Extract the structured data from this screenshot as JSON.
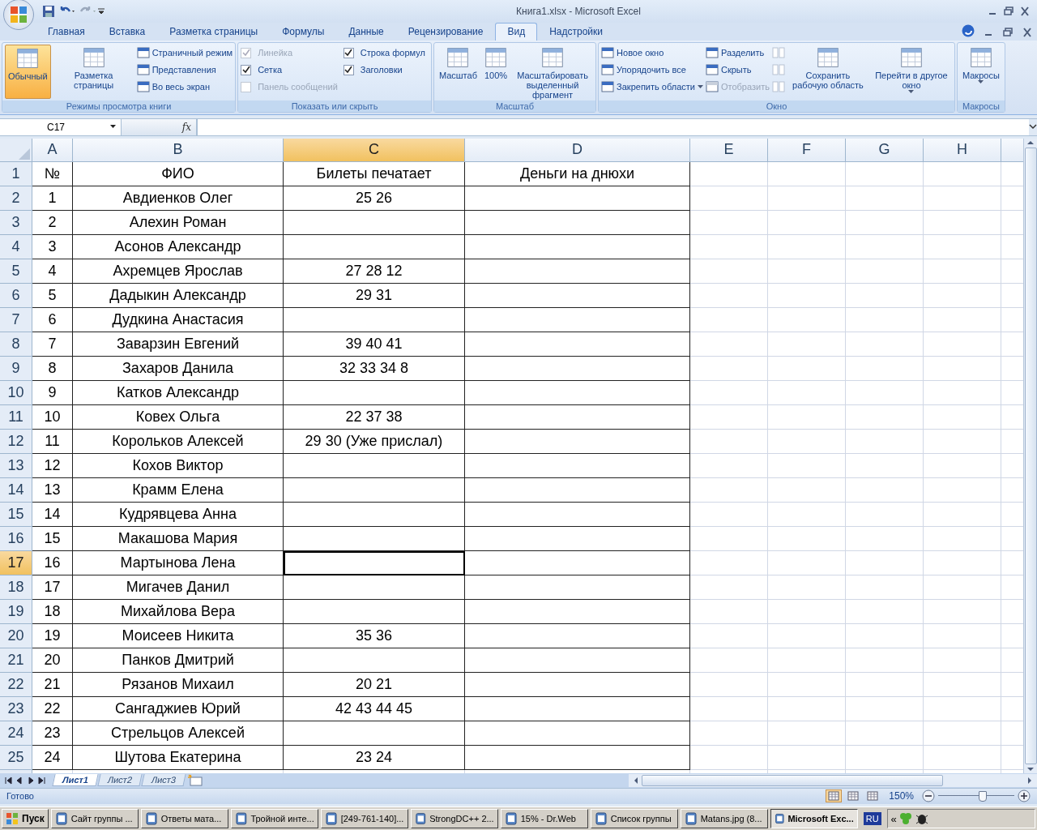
{
  "window": {
    "title": "Книга1.xlsx - Microsoft Excel"
  },
  "tabs": [
    {
      "label": "Главная",
      "selected": false
    },
    {
      "label": "Вставка",
      "selected": false
    },
    {
      "label": "Разметка страницы",
      "selected": false
    },
    {
      "label": "Формулы",
      "selected": false
    },
    {
      "label": "Данные",
      "selected": false
    },
    {
      "label": "Рецензирование",
      "selected": false
    },
    {
      "label": "Вид",
      "selected": true
    },
    {
      "label": "Надстройки",
      "selected": false
    }
  ],
  "ribbon": {
    "groups": [
      {
        "label": "Режимы просмотра книги",
        "blocks": [
          {
            "kind": "large",
            "label": "Обычный",
            "selected": true
          },
          {
            "kind": "large",
            "label": "Разметка страницы",
            "selected": false
          },
          {
            "kind": "stack",
            "items": [
              {
                "kind": "small",
                "label": "Страничный режим",
                "disabled": false
              },
              {
                "kind": "small",
                "label": "Представления",
                "disabled": false
              },
              {
                "kind": "small",
                "label": "Во весь экран",
                "disabled": false
              }
            ]
          }
        ]
      },
      {
        "label": "Показать или скрыть",
        "blocks": [
          {
            "kind": "stack",
            "items": [
              {
                "kind": "checkbox",
                "label": "Линейка",
                "checked": true,
                "disabled": true
              },
              {
                "kind": "checkbox",
                "label": "Сетка",
                "checked": true,
                "disabled": false
              },
              {
                "kind": "checkbox",
                "label": "Панель сообщений",
                "checked": false,
                "disabled": true
              }
            ]
          },
          {
            "kind": "stack",
            "items": [
              {
                "kind": "checkbox",
                "label": "Строка формул",
                "checked": true,
                "disabled": false
              },
              {
                "kind": "checkbox",
                "label": "Заголовки",
                "checked": true,
                "disabled": false
              }
            ]
          }
        ]
      },
      {
        "label": "Масштаб",
        "blocks": [
          {
            "kind": "large",
            "label": "Масштаб"
          },
          {
            "kind": "large",
            "label": "100%"
          },
          {
            "kind": "large",
            "label": "Масштабировать выделенный фрагмент"
          }
        ]
      },
      {
        "label": "Окно",
        "blocks": [
          {
            "kind": "stack",
            "items": [
              {
                "kind": "small",
                "label": "Новое окно",
                "disabled": false
              },
              {
                "kind": "small",
                "label": "Упорядочить все",
                "disabled": false
              },
              {
                "kind": "small",
                "label": "Закрепить области",
                "disabled": false,
                "dropdown": true
              }
            ]
          },
          {
            "kind": "stack",
            "items": [
              {
                "kind": "small",
                "label": "Разделить",
                "disabled": false
              },
              {
                "kind": "small",
                "label": "Скрыть",
                "disabled": false
              },
              {
                "kind": "small",
                "label": "Отобразить",
                "disabled": true
              }
            ]
          },
          {
            "kind": "stack",
            "items": [
              {
                "kind": "icon",
                "disabled": true
              },
              {
                "kind": "icon",
                "disabled": true
              },
              {
                "kind": "icon",
                "disabled": true
              }
            ]
          },
          {
            "kind": "large",
            "label": "Сохранить рабочую область"
          },
          {
            "kind": "large",
            "label": "Перейти в другое окно",
            "dropdown": true
          }
        ]
      },
      {
        "label": "Макросы",
        "blocks": [
          {
            "kind": "large",
            "label": "Макросы",
            "dropdown": true
          }
        ]
      }
    ]
  },
  "formula_bar": {
    "name_box": "C17",
    "function_label": "fx"
  },
  "columns": [
    {
      "label": "A",
      "selected": false
    },
    {
      "label": "B",
      "selected": false
    },
    {
      "label": "C",
      "selected": true
    },
    {
      "label": "D",
      "selected": false
    },
    {
      "label": "E",
      "selected": false
    },
    {
      "label": "F",
      "selected": false
    },
    {
      "label": "G",
      "selected": false
    },
    {
      "label": "H",
      "selected": false
    }
  ],
  "rows": [
    {
      "number": "1",
      "selected": false,
      "a": "№",
      "b": "ФИО",
      "c": "Билеты печатает",
      "d": "Деньги на днюхи"
    },
    {
      "number": "2",
      "selected": false,
      "a": "1",
      "b": "Авдиенков Олег",
      "c": "25 26"
    },
    {
      "number": "3",
      "selected": false,
      "a": "2",
      "b": "Алехин Роман"
    },
    {
      "number": "4",
      "selected": false,
      "a": "3",
      "b": "Асонов Александр"
    },
    {
      "number": "5",
      "selected": false,
      "a": "4",
      "b": "Ахремцев Ярослав",
      "c": "27 28 12"
    },
    {
      "number": "6",
      "selected": false,
      "a": "5",
      "b": "Дадыкин Александр",
      "c": "29 31"
    },
    {
      "number": "7",
      "selected": false,
      "a": "6",
      "b": "Дудкина Анастасия"
    },
    {
      "number": "8",
      "selected": false,
      "a": "7",
      "b": "Заварзин Евгений",
      "c": "39 40 41"
    },
    {
      "number": "9",
      "selected": false,
      "a": "8",
      "b": "Захаров Данила",
      "c": "32 33 34  8"
    },
    {
      "number": "10",
      "selected": false,
      "a": "9",
      "b": "Катков Александр"
    },
    {
      "number": "11",
      "selected": false,
      "a": "10",
      "b": "Ковех Ольга",
      "c": "22 37 38"
    },
    {
      "number": "12",
      "selected": false,
      "a": "11",
      "b": "Корольков Алексей",
      "c": "29 30 (Уже прислал)"
    },
    {
      "number": "13",
      "selected": false,
      "a": "12",
      "b": "Кохов Виктор"
    },
    {
      "number": "14",
      "selected": false,
      "a": "13",
      "b": "Крамм Елена"
    },
    {
      "number": "15",
      "selected": false,
      "a": "14",
      "b": "Кудрявцева Анна"
    },
    {
      "number": "16",
      "selected": false,
      "a": "15",
      "b": "Макашова Мария"
    },
    {
      "number": "17",
      "selected": true,
      "a": "16",
      "b": "Мартынова Лена"
    },
    {
      "number": "18",
      "selected": false,
      "a": "17",
      "b": "Мигачев Данил"
    },
    {
      "number": "19",
      "selected": false,
      "a": "18",
      "b": "Михайлова Вера"
    },
    {
      "number": "20",
      "selected": false,
      "a": "19",
      "b": "Моисеев Никита",
      "c": "35 36"
    },
    {
      "number": "21",
      "selected": false,
      "a": "20",
      "b": "Панков Дмитрий"
    },
    {
      "number": "22",
      "selected": false,
      "a": "21",
      "b": "Рязанов Михаил",
      "c": "20 21"
    },
    {
      "number": "23",
      "selected": false,
      "a": "22",
      "b": "Сангаджиев Юрий",
      "c": "42 43 44 45"
    },
    {
      "number": "24",
      "selected": false,
      "a": "23",
      "b": "Стрельцов Алексей"
    },
    {
      "number": "25",
      "selected": false,
      "a": "24",
      "b": "Шутова Екатерина",
      "c": "23 24"
    }
  ],
  "sheets": [
    {
      "label": "Лист1",
      "selected": true
    },
    {
      "label": "Лист2",
      "selected": false
    },
    {
      "label": "Лист3",
      "selected": false
    }
  ],
  "status_bar": {
    "text": "Готово",
    "views": [
      {
        "selected": true
      },
      {
        "selected": false
      },
      {
        "selected": false
      }
    ],
    "zoom": "150%",
    "zoom_slider": {
      "level": 0.58
    }
  },
  "taskbar": {
    "start": "Пуск",
    "items": [
      {
        "label": "Сайт группы ...",
        "selected": false
      },
      {
        "label": "Ответы мата...",
        "selected": false
      },
      {
        "label": "Тройной инте...",
        "selected": false
      },
      {
        "label": "[249-761-140]...",
        "selected": false
      },
      {
        "label": "StrongDC++ 2...",
        "selected": false
      },
      {
        "label": "15% - Dr.Web",
        "selected": false
      },
      {
        "label": "Список группы",
        "selected": false
      },
      {
        "label": "Matans.jpg (8...",
        "selected": false
      },
      {
        "label": "Microsoft Exc...",
        "selected": true
      }
    ],
    "language": "RU",
    "tray_toggle": "«"
  }
}
